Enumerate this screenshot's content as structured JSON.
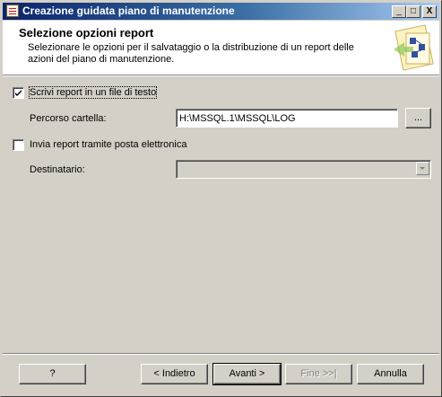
{
  "window": {
    "title": "Creazione guidata piano di manutenzione",
    "minimize": "_",
    "maximize": "□",
    "close": "X"
  },
  "header": {
    "title": "Selezione opzioni report",
    "description": "Selezionare le opzioni per il salvataggio o la distribuzione di un report delle azioni del piano di manutenzione."
  },
  "options": {
    "write_text_file": {
      "label": "Scrivi report in un file di testo",
      "checked": true
    },
    "folder_path": {
      "label": "Percorso cartella:",
      "value": "H:\\MSSQL.1\\MSSQL\\LOG",
      "browse": "..."
    },
    "send_email": {
      "label": "Invia report tramite posta elettronica",
      "checked": false
    },
    "recipient": {
      "label": "Destinatario:",
      "value": ""
    }
  },
  "footer": {
    "help": "?",
    "back": "< Indietro",
    "next": "Avanti >",
    "finish": "Fine >>|",
    "cancel": "Annulla"
  }
}
